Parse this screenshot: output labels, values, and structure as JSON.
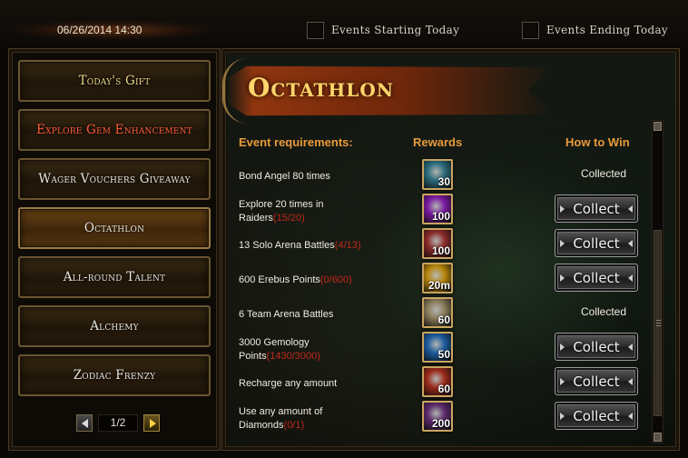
{
  "header": {
    "datetime": "06/26/2014 14:30",
    "filter_starting": "Events Starting Today",
    "filter_ending": "Events Ending Today"
  },
  "sidebar": {
    "items": [
      {
        "label": "Today's Gift",
        "style": "gold",
        "active": false
      },
      {
        "label": "Explore Gem Enhancement",
        "style": "red",
        "active": false
      },
      {
        "label": "Wager Vouchers Giveaway",
        "style": "white",
        "active": false
      },
      {
        "label": "Octathlon",
        "style": "white",
        "active": true
      },
      {
        "label": "All-round Talent",
        "style": "white",
        "active": false
      },
      {
        "label": "Alchemy",
        "style": "white",
        "active": false
      },
      {
        "label": "Zodiac Frenzy",
        "style": "white",
        "active": false
      }
    ],
    "pager": {
      "text": "1/2"
    }
  },
  "event": {
    "title": "Octathlon",
    "columns": {
      "requirements": "Event requirements:",
      "rewards": "Rewards",
      "how_to_win": "How to Win"
    },
    "rows": [
      {
        "req": "Bond Angel 80 times",
        "req2": "",
        "progress": "",
        "qty": "30",
        "icon": "angel-crystal-icon",
        "color": "#2a6a7a",
        "status": "collected",
        "action": "Collected"
      },
      {
        "req": "Explore 20 times in",
        "req2": "Raiders",
        "progress": "(15/20)",
        "qty": "100",
        "icon": "purple-orb-icon",
        "color": "#7a1aa0",
        "status": "collect",
        "action": "Collect"
      },
      {
        "req": "13 Solo Arena Battles",
        "req2": "",
        "progress": "(4/13)",
        "qty": "100",
        "icon": "arena-sword-icon",
        "color": "#8a2a2a",
        "status": "collect",
        "action": "Collect"
      },
      {
        "req": "600 Erebus Points",
        "req2": "",
        "progress": "(0/600)",
        "qty": "20m",
        "icon": "gold-coin-icon",
        "color": "#b8860b",
        "status": "collect",
        "action": "Collect"
      },
      {
        "req": "6 Team Arena Battles",
        "req2": "",
        "progress": "",
        "qty": "60",
        "icon": "pearl-icon",
        "color": "#8a7a5a",
        "status": "collected",
        "action": "Collected"
      },
      {
        "req": "3000 Gemology",
        "req2": "Points",
        "progress": "(1430/3000)",
        "qty": "50",
        "icon": "gem-50-icon",
        "color": "#1a5a9a",
        "status": "collect",
        "action": "Collect"
      },
      {
        "req": "Recharge any amount",
        "req2": "",
        "progress": "",
        "qty": "60",
        "icon": "red-gem-icon",
        "color": "#9a2a1a",
        "status": "collect",
        "action": "Collect"
      },
      {
        "req": "Use any amount of",
        "req2": "Diamonds",
        "progress": "(0/1)",
        "qty": "200",
        "icon": "scroll-book-icon",
        "color": "#5a2a6a",
        "status": "collect",
        "action": "Collect"
      }
    ]
  }
}
